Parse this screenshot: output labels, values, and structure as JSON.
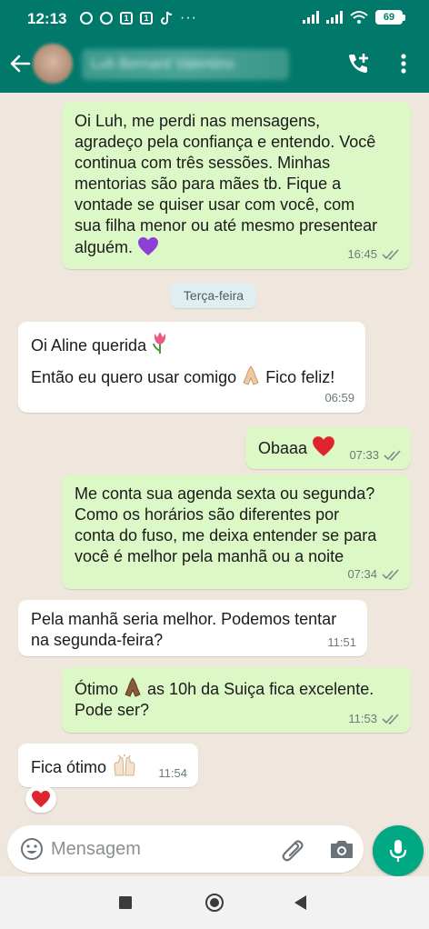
{
  "status_bar": {
    "time": "12:13",
    "notif_icon_1": "1",
    "notif_icon_2": "1",
    "more": "···",
    "battery": "69"
  },
  "header": {
    "contact_name": "Luh Bernard Valentino"
  },
  "messages": [
    {
      "direction": "out",
      "text": "Oi Luh, me perdi nas mensagens,\nagradeço pela confiança e entendo. Você\ncontinua com três sessões. Minhas\nmentorias são para mães tb. Fique a\nvontade se quiser usar com você, com\nsua filha menor ou até mesmo presentear\nalguém.",
      "emoji": "purple-heart",
      "time": "16:45",
      "status": "read"
    },
    {
      "direction": "in",
      "line1": "Oi Aline querida",
      "line2_a": "Então eu quero usar comigo",
      "line2_b": "Fico feliz!",
      "time": "06:59"
    },
    {
      "direction": "out",
      "text": "Obaaa",
      "emoji": "red-heart",
      "time": "07:33",
      "status": "read"
    },
    {
      "direction": "out",
      "text": "Me conta sua agenda sexta ou segunda?\nComo os horários são diferentes por\nconta do fuso, me deixa entender se para\nvocê é melhor pela manhã ou a noite",
      "time": "07:34",
      "status": "read"
    },
    {
      "direction": "in",
      "text": "Pela manhã seria melhor. Podemos tentar\nna segunda-feira?",
      "time": "11:51"
    },
    {
      "direction": "out",
      "text_a": "Ótimo",
      "text_b": "as 10h da Suiça fica excelente.",
      "text_c": "Pode ser?",
      "time": "11:53",
      "status": "read"
    },
    {
      "direction": "in",
      "text": "Fica ótimo",
      "time": "11:54"
    }
  ],
  "date_separator": "Terça-feira",
  "reaction": "red-heart",
  "input": {
    "placeholder": "Mensagem"
  },
  "colors": {
    "header": "#00796b",
    "chat_background": "#efe7de",
    "outgoing_bubble": "#dcf8c6",
    "incoming_bubble": "#ffffff",
    "mic_button": "#00a884"
  },
  "icons": [
    "back-arrow-icon",
    "add-call-icon",
    "more-vert-icon",
    "emoji-icon",
    "attach-icon",
    "camera-icon",
    "mic-icon",
    "read-ticks-icon"
  ]
}
